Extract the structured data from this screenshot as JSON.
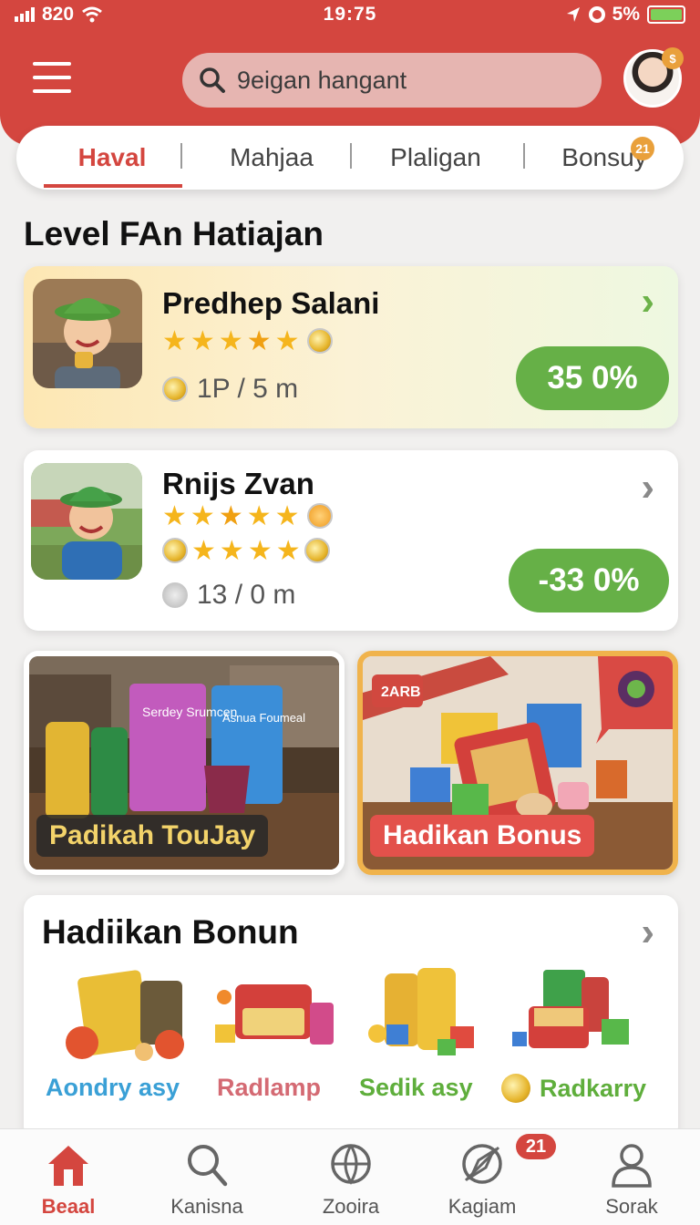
{
  "status_bar": {
    "signal": "820",
    "time": "19:75",
    "battery": "5%"
  },
  "header": {
    "search_placeholder": "9eigan hangant"
  },
  "tabs": [
    {
      "label": "Haval",
      "active": true
    },
    {
      "label": "Mahjaa",
      "active": false
    },
    {
      "label": "Plaligan",
      "active": false
    },
    {
      "label": "Bonsuy",
      "active": false,
      "badge": "21"
    }
  ],
  "section_title": "Level FAn Hatiajan",
  "cards": [
    {
      "name": "Predhep Salani",
      "rating": 5,
      "distance": "1P / 5 m",
      "percent": "35 0%"
    },
    {
      "name": "Rnijs Zvan",
      "rating": 5,
      "distance": "13 / 0 m",
      "percent": "-33 0%"
    }
  ],
  "promos": [
    {
      "label": "Padikah TouJay",
      "packs": [
        "Serdey Srumcen",
        "Asnua Foumeal"
      ]
    },
    {
      "label": "Hadikan Bonus",
      "sign": "2ARB"
    }
  ],
  "bonus_section": {
    "title": "Hadiikan Bonun",
    "items": [
      {
        "label": "Aondry asy",
        "color": "#3aa0d6"
      },
      {
        "label": "Radlamp",
        "color": "#d46a73"
      },
      {
        "label": "Sedik asy",
        "color": "#5fae3c"
      },
      {
        "label": "Radkarry",
        "color": "#5fae3c"
      }
    ]
  },
  "bottom_nav": [
    {
      "label": "Beaal",
      "icon": "home-icon",
      "active": true
    },
    {
      "label": "Kanisna",
      "icon": "search-icon",
      "active": false
    },
    {
      "label": "Zooira",
      "icon": "globe-icon",
      "active": false
    },
    {
      "label": "Kagiam",
      "icon": "compass-icon",
      "active": false,
      "badge": "21"
    },
    {
      "label": "Sorak",
      "icon": "profile-icon",
      "active": false
    }
  ],
  "colors": {
    "brand": "#d4463f",
    "accent_green": "#66b047",
    "badge_orange": "#e9a03b"
  }
}
